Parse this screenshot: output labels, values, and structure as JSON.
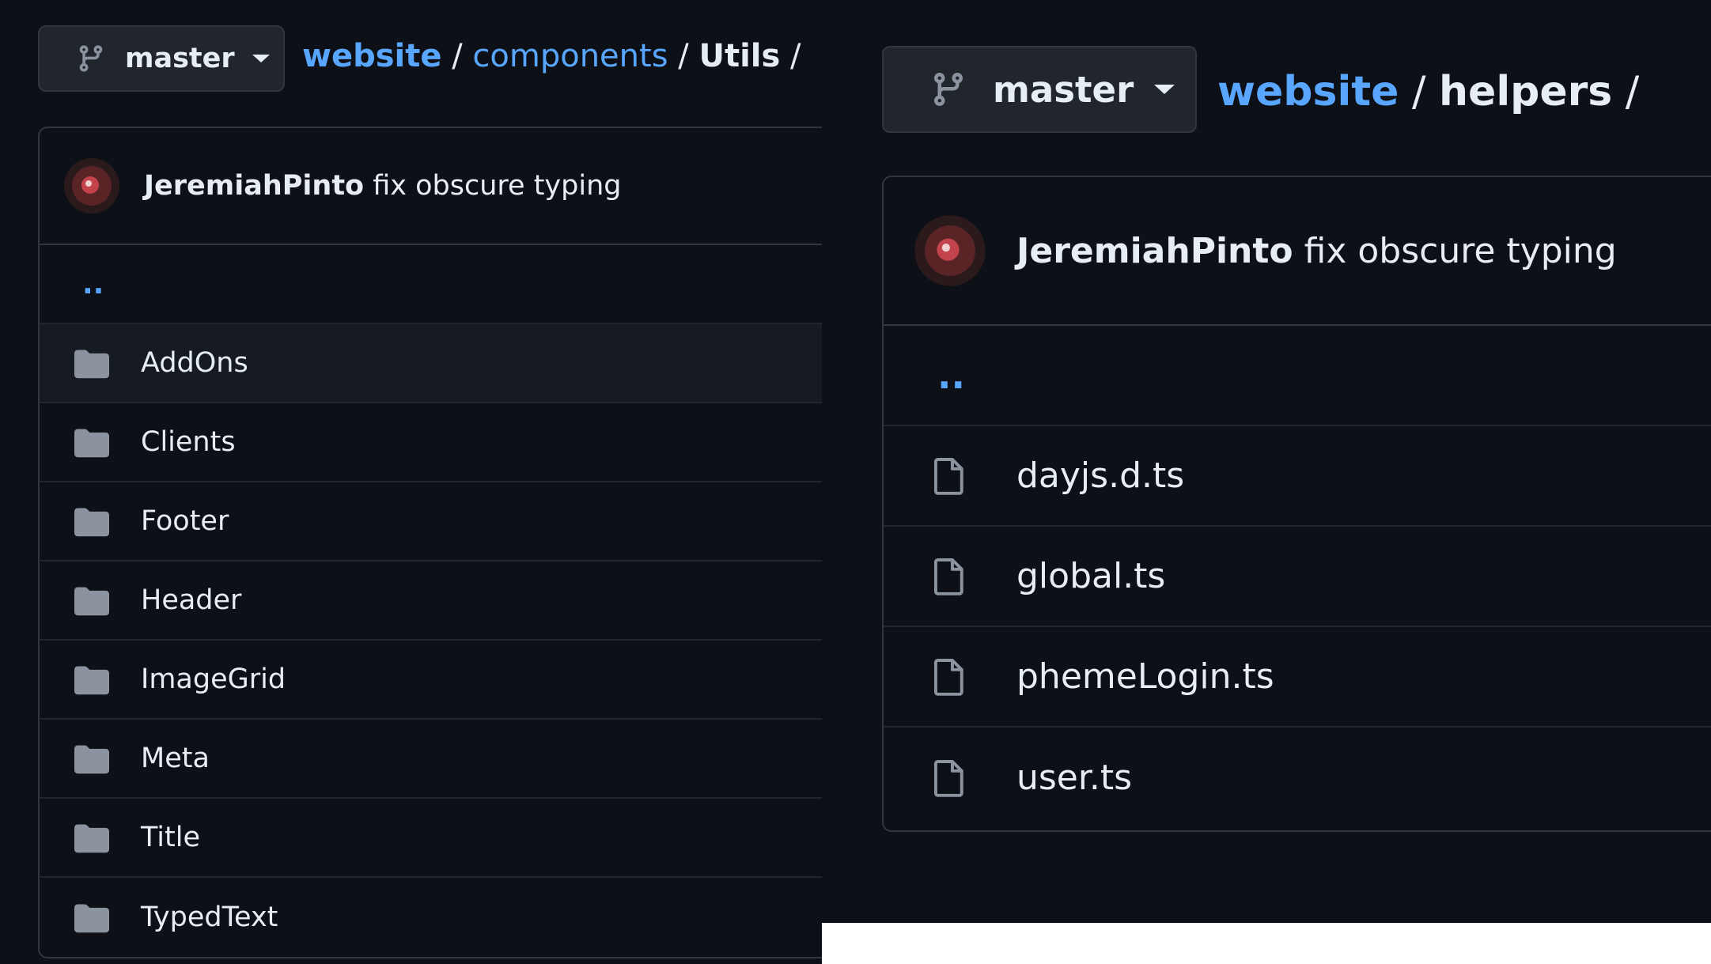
{
  "left": {
    "branch": {
      "icon": "git-branch-icon",
      "label": "master"
    },
    "breadcrumb": {
      "root": "website",
      "parts": [
        "components"
      ],
      "current": "Utils",
      "sep": "/"
    },
    "commit": {
      "author": "JeremiahPinto",
      "message": "fix obscure typing"
    },
    "parent_link": "..",
    "items": [
      {
        "type": "folder",
        "name": "AddOns"
      },
      {
        "type": "folder",
        "name": "Clients"
      },
      {
        "type": "folder",
        "name": "Footer"
      },
      {
        "type": "folder",
        "name": "Header"
      },
      {
        "type": "folder",
        "name": "ImageGrid"
      },
      {
        "type": "folder",
        "name": "Meta"
      },
      {
        "type": "folder",
        "name": "Title"
      },
      {
        "type": "folder",
        "name": "TypedText"
      }
    ]
  },
  "right": {
    "branch": {
      "icon": "git-branch-icon",
      "label": "master"
    },
    "breadcrumb": {
      "root": "website",
      "parts": [],
      "current": "helpers",
      "sep": "/"
    },
    "commit": {
      "author": "JeremiahPinto",
      "message": "fix obscure typing"
    },
    "parent_link": "..",
    "items": [
      {
        "type": "file",
        "name": "dayjs.d.ts"
      },
      {
        "type": "file",
        "name": "global.ts"
      },
      {
        "type": "file",
        "name": "phemeLogin.ts"
      },
      {
        "type": "file",
        "name": "user.ts"
      }
    ]
  },
  "colors": {
    "background": "#0d1117",
    "link": "#58a6ff",
    "text": "#e6edf3",
    "border": "#30363d",
    "icon": "#8b949e",
    "button_bg": "#21262d"
  }
}
